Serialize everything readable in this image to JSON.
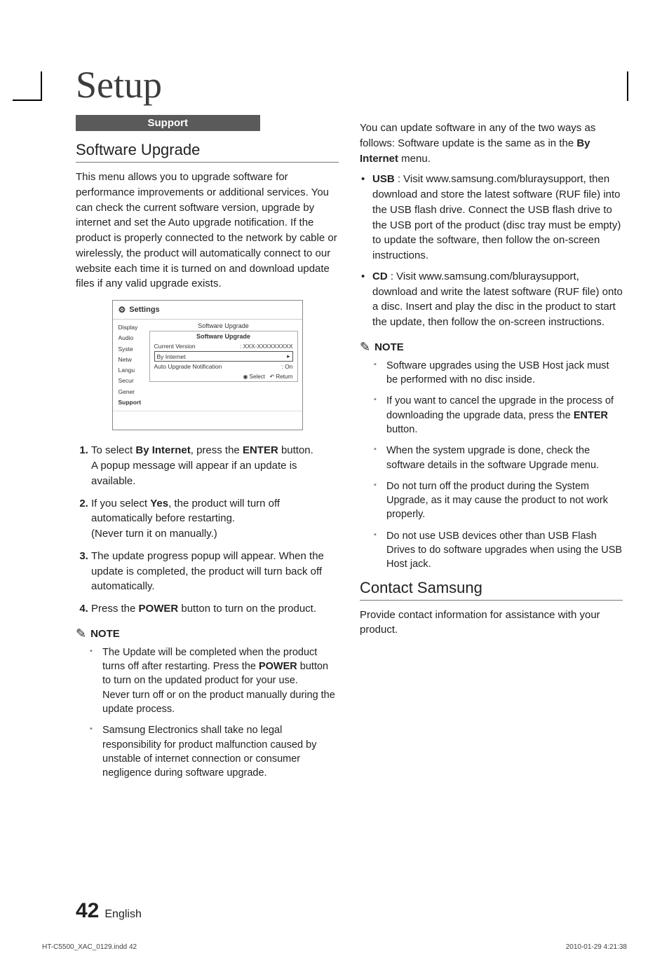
{
  "title": "Setup",
  "support_label": "Support",
  "left": {
    "h_software": "Software Upgrade",
    "intro": "This menu allows you to upgrade software for performance improvements or additional services. You can check the current software version, upgrade by internet and set the Auto upgrade notification. If the product is properly connected to the network by cable or wirelessly, the product will automatically connect to our website each time it is turned on and download update files if any valid upgrade exists.",
    "shot": {
      "top": "Settings",
      "side": [
        "Display",
        "Audio",
        "Syste",
        "Netw",
        "Langu",
        "Secur",
        "Gener",
        "Support"
      ],
      "main_h": "Software Upgrade",
      "sub_h": "Software Upgrade",
      "cur_ver_l": "Current Version",
      "cur_ver_v": ": XXX-XXXXXXXXX",
      "by_internet": "By Internet",
      "arrow": "▸",
      "auto_l": "Auto Upgrade Notification",
      "auto_v": ": On",
      "foot_select": "Select",
      "foot_return": "Return"
    },
    "steps": {
      "s1a": "To select ",
      "s1b": "By Internet",
      "s1c": ", press the ",
      "s1d": "ENTER",
      "s1e": " button.",
      "s1f": "A popup message will appear if an update is available.",
      "s2a": "If you select ",
      "s2b": "Yes",
      "s2c": ", the product will turn off automatically before restarting.",
      "s2d": "(Never turn it on manually.)",
      "s3": "The update progress popup will appear. When the update is completed, the product will turn back off automatically.",
      "s4a": "Press the ",
      "s4b": "POWER",
      "s4c": " button to turn on the product."
    },
    "note_label": "NOTE",
    "notes": {
      "n1a": "The Update will be completed when the product turns off after restarting. Press the ",
      "n1b": "POWER",
      "n1c": " button to turn on the updated product for your use.",
      "n1d": "Never turn off or on the product manually during the update process.",
      "n2": "Samsung Electronics shall take no legal responsibility for product malfunction caused by unstable of internet connection or consumer negligence during software upgrade."
    }
  },
  "right": {
    "p1a": "You can update software in any of the two ways as follows: Software update is the same as in the ",
    "p1b": "By Internet",
    "p1c": " menu.",
    "usb_b": "USB",
    "usb_t": " : Visit www.samsung.com/bluraysupport, then download and store the latest software (RUF file) into the USB flash drive. Connect the USB flash drive to the USB port of the product (disc tray must be empty) to update the software, then follow the on-screen instructions.",
    "cd_b": "CD",
    "cd_t": " : Visit www.samsung.com/bluraysupport, download and write the latest software (RUF file) onto a disc. Insert and play the disc in the product to start the update, then follow the on-screen instructions.",
    "note_label": "NOTE",
    "notes": {
      "n1": "Software upgrades using the USB Host jack must be performed with no disc inside.",
      "n2a": "If you want to cancel the upgrade in the process of downloading the upgrade data, press the ",
      "n2b": "ENTER",
      "n2c": " button.",
      "n3": "When the system upgrade is done, check the software details in the software Upgrade menu.",
      "n4": "Do not turn off the product during the System Upgrade, as it may cause the product to not work properly.",
      "n5": "Do not use USB devices other than USB Flash Drives to do software upgrades when using the USB Host jack."
    },
    "h_contact": "Contact Samsung",
    "contact_p": "Provide contact information for assistance with your product."
  },
  "footer": {
    "pagenum": "42",
    "lang": "English",
    "indd": "HT-C5500_XAC_0129.indd   42",
    "ts": "2010-01-29   4:21:38"
  }
}
